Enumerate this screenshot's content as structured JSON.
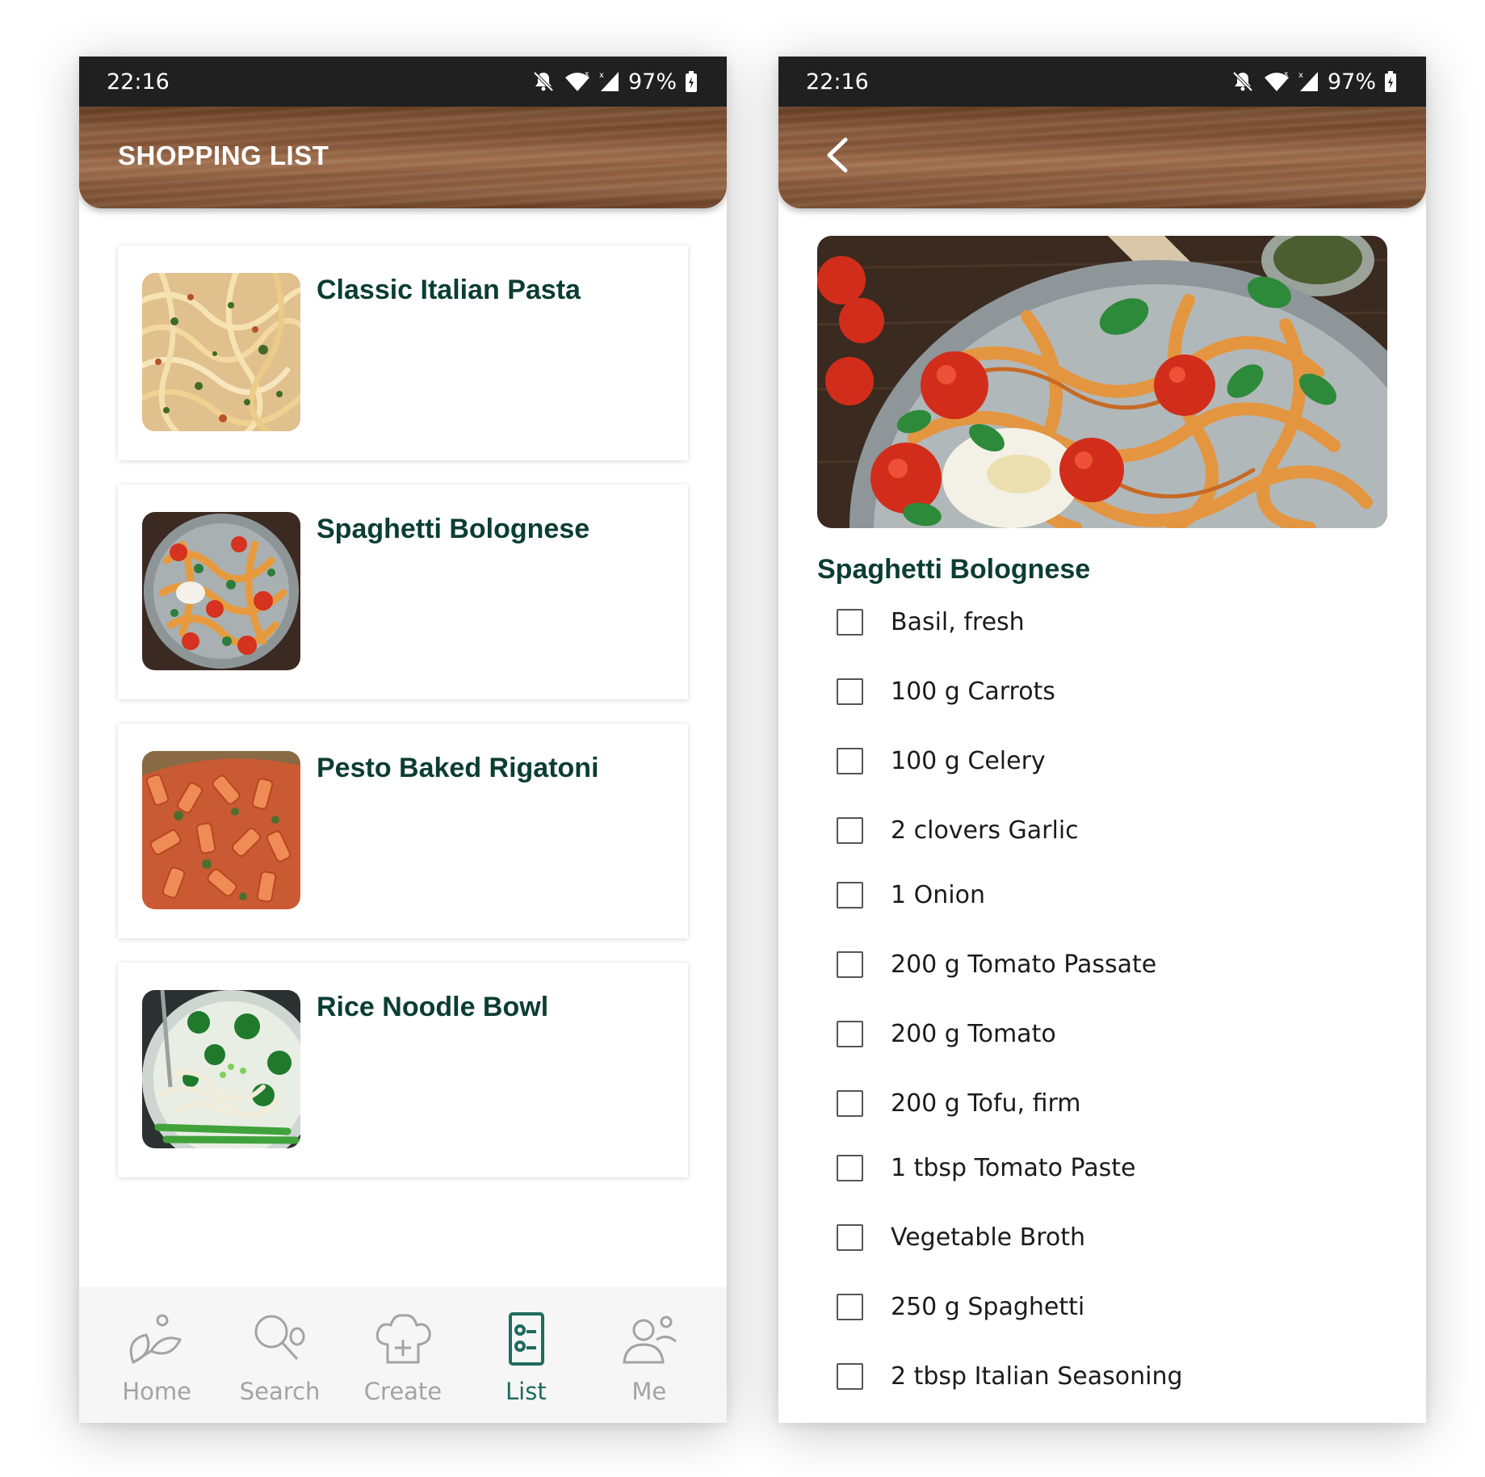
{
  "shopping_list_screen": {
    "status_bar": {
      "time": "22:16",
      "battery": "97%"
    },
    "header": {
      "title": "SHOPPING LIST"
    },
    "recipes": [
      {
        "title": "Classic Italian Pasta",
        "image": "pasta-photo"
      },
      {
        "title": "Spaghetti Bolognese",
        "image": "bolognese-photo"
      },
      {
        "title": "Pesto Baked Rigatoni",
        "image": "rigatoni-photo"
      },
      {
        "title": "Rice Noodle Bowl",
        "image": "noodle-bowl-photo"
      }
    ],
    "tab_bar": {
      "active": "List",
      "accent_color": "#1e6b5f",
      "inactive_color": "#a3a3a3",
      "tabs": [
        {
          "label": "Home",
          "icon": "leaves-icon"
        },
        {
          "label": "Search",
          "icon": "search-icon"
        },
        {
          "label": "Create",
          "icon": "chef-hat-plus-icon"
        },
        {
          "label": "List",
          "icon": "checklist-icon"
        },
        {
          "label": "Me",
          "icon": "people-icon"
        }
      ]
    }
  },
  "recipe_detail_screen": {
    "status_bar": {
      "time": "22:16",
      "battery": "97%"
    },
    "header": {
      "back_icon": "chevron-left-icon"
    },
    "hero_image": "bolognese-photo",
    "title": "Spaghetti Bolognese",
    "ingredients": [
      {
        "label": "Basil, fresh",
        "checked": false
      },
      {
        "label": "100 g Carrots",
        "checked": false
      },
      {
        "label": "100 g Celery",
        "checked": false
      },
      {
        "label": "2 clovers Garlic",
        "checked": false
      },
      {
        "label": "1 Onion",
        "checked": false
      },
      {
        "label": "200 g Tomato Passate",
        "checked": false
      },
      {
        "label": "200 g Tomato",
        "checked": false
      },
      {
        "label": "200 g Tofu, firm",
        "checked": false
      },
      {
        "label": "1 tbsp Tomato Paste",
        "checked": false
      },
      {
        "label": "Vegetable Broth",
        "checked": false
      },
      {
        "label": "250 g Spaghetti",
        "checked": false
      },
      {
        "label": "2 tbsp Italian Seasoning",
        "checked": false
      }
    ]
  },
  "colors": {
    "title_green": "#0b3d34",
    "status_bar": "#202020",
    "wood": "#8c5d3e"
  }
}
